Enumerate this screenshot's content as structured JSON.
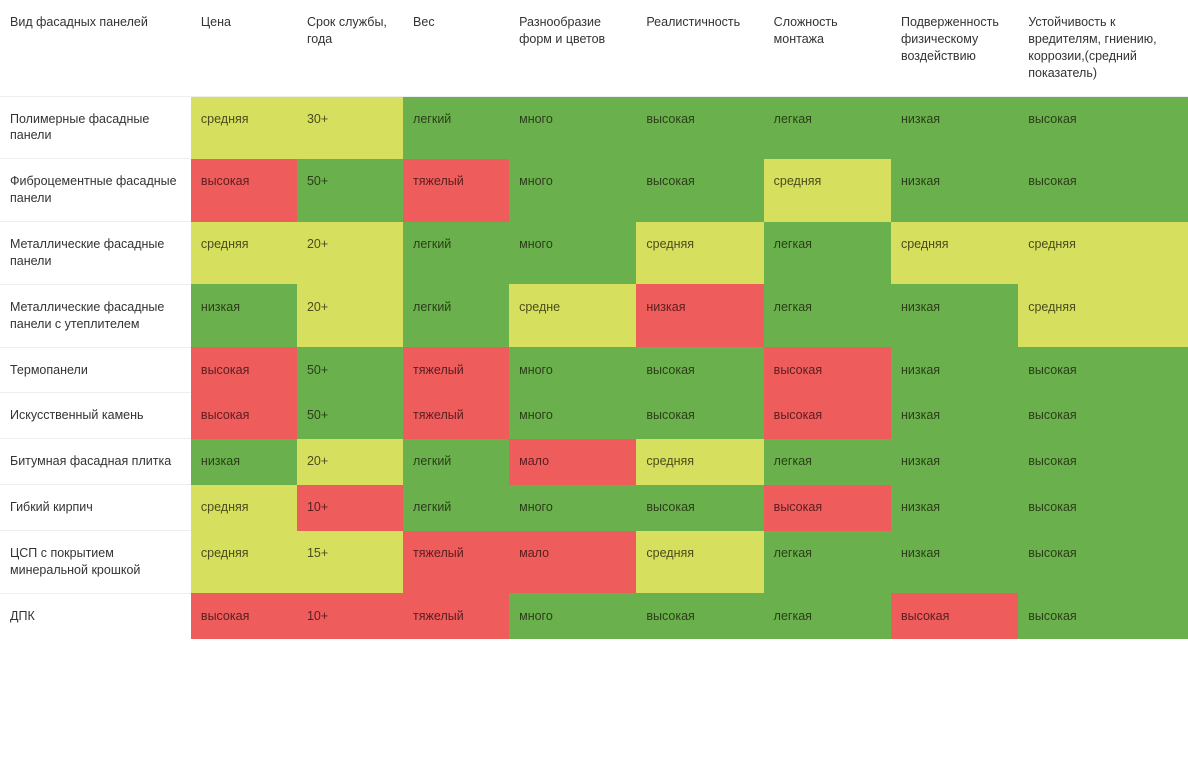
{
  "colors": {
    "green": "#6ab04c",
    "yellow": "#d7df5e",
    "red": "#ee5c5c"
  },
  "columns": [
    "Вид фасадных панелей",
    "Цена",
    "Срок службы, года",
    "Вес",
    "Разнообразие форм и цветов",
    "Реалистичность",
    "Сложность монтажа",
    "Подверженность физическому воздействию",
    "Устойчивость к вредителям, гниению, коррозии,(средний показатель)"
  ],
  "rows": [
    {
      "name": "Полимерные фасадные панели",
      "cells": [
        {
          "v": "средняя",
          "c": "yellow"
        },
        {
          "v": "30+",
          "c": "yellow"
        },
        {
          "v": "легкий",
          "c": "green"
        },
        {
          "v": "много",
          "c": "green"
        },
        {
          "v": "высокая",
          "c": "green"
        },
        {
          "v": "легкая",
          "c": "green"
        },
        {
          "v": "низкая",
          "c": "green"
        },
        {
          "v": "высокая",
          "c": "green"
        }
      ]
    },
    {
      "name": "Фиброцементные фасадные панели",
      "cells": [
        {
          "v": "высокая",
          "c": "red"
        },
        {
          "v": "50+",
          "c": "green"
        },
        {
          "v": "тяжелый",
          "c": "red"
        },
        {
          "v": "много",
          "c": "green"
        },
        {
          "v": "высокая",
          "c": "green"
        },
        {
          "v": "средняя",
          "c": "yellow"
        },
        {
          "v": "низкая",
          "c": "green"
        },
        {
          "v": "высокая",
          "c": "green"
        }
      ]
    },
    {
      "name": "Металлические фасадные панели",
      "cells": [
        {
          "v": "средняя",
          "c": "yellow"
        },
        {
          "v": "20+",
          "c": "yellow"
        },
        {
          "v": "легкий",
          "c": "green"
        },
        {
          "v": "много",
          "c": "green"
        },
        {
          "v": "средняя",
          "c": "yellow"
        },
        {
          "v": "легкая",
          "c": "green"
        },
        {
          "v": "средняя",
          "c": "yellow"
        },
        {
          "v": "средняя",
          "c": "yellow"
        }
      ]
    },
    {
      "name": "Металлические фасадные панели с утеплителем",
      "cells": [
        {
          "v": "низкая",
          "c": "green"
        },
        {
          "v": "20+",
          "c": "yellow"
        },
        {
          "v": "легкий",
          "c": "green"
        },
        {
          "v": "средне",
          "c": "yellow"
        },
        {
          "v": "низкая",
          "c": "red"
        },
        {
          "v": "легкая",
          "c": "green"
        },
        {
          "v": "низкая",
          "c": "green"
        },
        {
          "v": "средняя",
          "c": "yellow"
        }
      ]
    },
    {
      "name": "Термопанели",
      "cells": [
        {
          "v": "высокая",
          "c": "red"
        },
        {
          "v": "50+",
          "c": "green"
        },
        {
          "v": "тяжелый",
          "c": "red"
        },
        {
          "v": "много",
          "c": "green"
        },
        {
          "v": "высокая",
          "c": "green"
        },
        {
          "v": "высокая",
          "c": "red"
        },
        {
          "v": "низкая",
          "c": "green"
        },
        {
          "v": "высокая",
          "c": "green"
        }
      ]
    },
    {
      "name": "Искусственный камень",
      "cells": [
        {
          "v": "высокая",
          "c": "red"
        },
        {
          "v": "50+",
          "c": "green"
        },
        {
          "v": "тяжелый",
          "c": "red"
        },
        {
          "v": "много",
          "c": "green"
        },
        {
          "v": "высокая",
          "c": "green"
        },
        {
          "v": "высокая",
          "c": "red"
        },
        {
          "v": "низкая",
          "c": "green"
        },
        {
          "v": "высокая",
          "c": "green"
        }
      ]
    },
    {
      "name": "Битумная фасадная плитка",
      "cells": [
        {
          "v": "низкая",
          "c": "green"
        },
        {
          "v": "20+",
          "c": "yellow"
        },
        {
          "v": "легкий",
          "c": "green"
        },
        {
          "v": "мало",
          "c": "red"
        },
        {
          "v": "средняя",
          "c": "yellow"
        },
        {
          "v": "легкая",
          "c": "green"
        },
        {
          "v": "низкая",
          "c": "green"
        },
        {
          "v": "высокая",
          "c": "green"
        }
      ]
    },
    {
      "name": "Гибкий кирпич",
      "cells": [
        {
          "v": "средняя",
          "c": "yellow"
        },
        {
          "v": "10+",
          "c": "red"
        },
        {
          "v": "легкий",
          "c": "green"
        },
        {
          "v": "много",
          "c": "green"
        },
        {
          "v": "высокая",
          "c": "green"
        },
        {
          "v": "высокая",
          "c": "red"
        },
        {
          "v": "низкая",
          "c": "green"
        },
        {
          "v": "высокая",
          "c": "green"
        }
      ]
    },
    {
      "name": "ЦСП с покрытием минеральной крошкой",
      "cells": [
        {
          "v": "средняя",
          "c": "yellow"
        },
        {
          "v": "15+",
          "c": "yellow"
        },
        {
          "v": "тяжелый",
          "c": "red"
        },
        {
          "v": "мало",
          "c": "red"
        },
        {
          "v": "средняя",
          "c": "yellow"
        },
        {
          "v": "легкая",
          "c": "green"
        },
        {
          "v": "низкая",
          "c": "green"
        },
        {
          "v": "высокая",
          "c": "green"
        }
      ]
    },
    {
      "name": "ДПК",
      "cells": [
        {
          "v": "высокая",
          "c": "red"
        },
        {
          "v": "10+",
          "c": "red"
        },
        {
          "v": "тяжелый",
          "c": "red"
        },
        {
          "v": "много",
          "c": "green"
        },
        {
          "v": "высокая",
          "c": "green"
        },
        {
          "v": "легкая",
          "c": "green"
        },
        {
          "v": "высокая",
          "c": "red"
        },
        {
          "v": "высокая",
          "c": "green"
        }
      ]
    }
  ]
}
